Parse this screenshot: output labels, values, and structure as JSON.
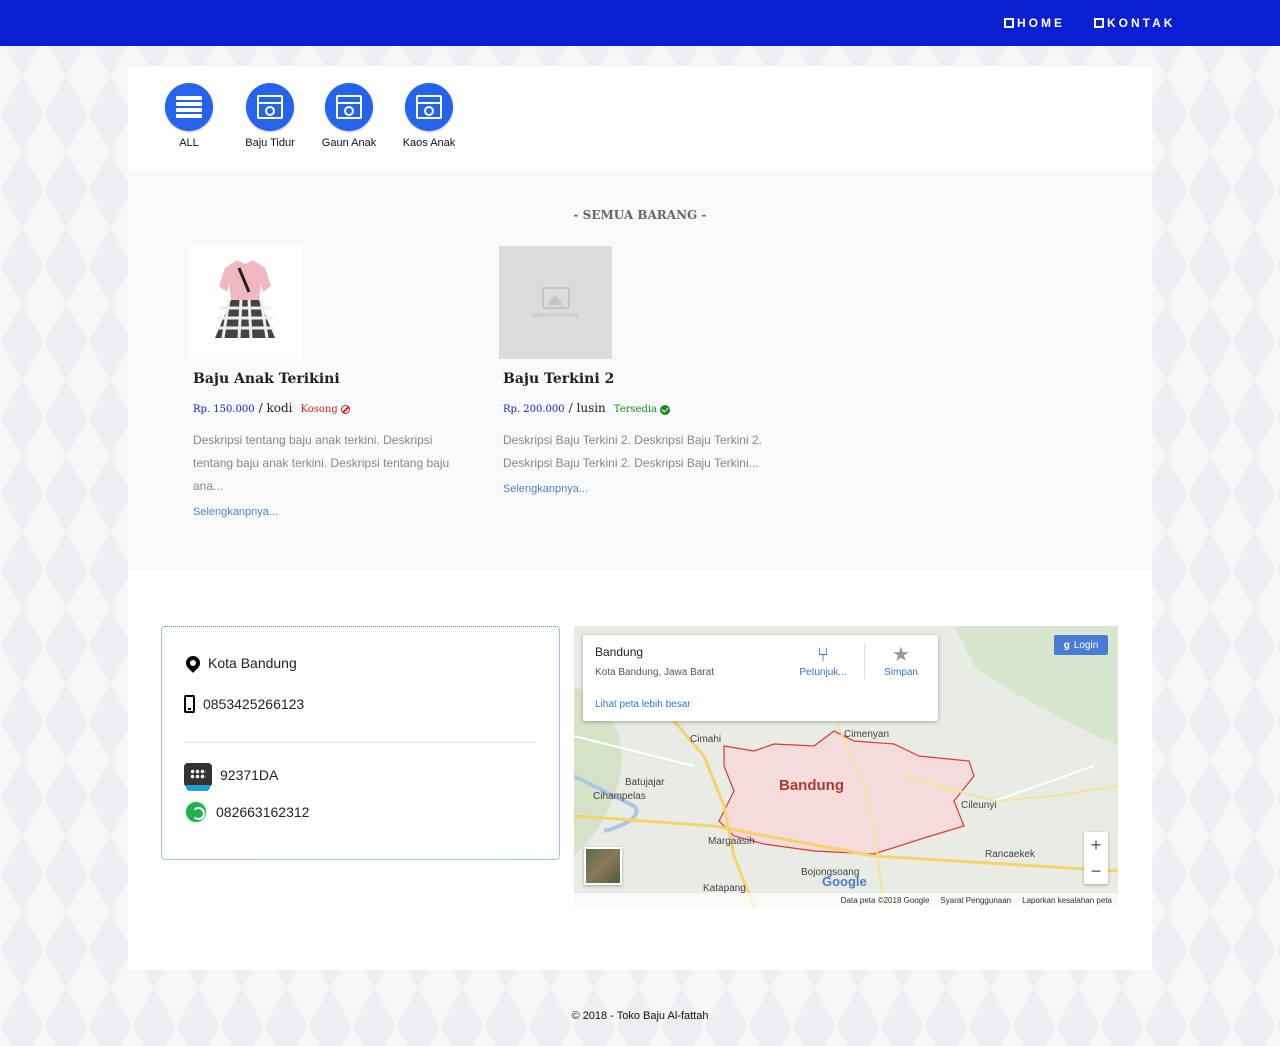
{
  "nav": {
    "home": "HOME",
    "kontak": "KONTAK"
  },
  "categories": [
    {
      "label": "ALL",
      "icon": "list-icon"
    },
    {
      "label": "Baju Tidur",
      "icon": "washer-icon"
    },
    {
      "label": "Gaun Anak",
      "icon": "washer-icon"
    },
    {
      "label": "Kaos Anak",
      "icon": "washer-icon"
    }
  ],
  "section_title": "- SEMUA BARANG -",
  "products": [
    {
      "name": "Baju Anak Terikini",
      "price": "Rp. 150.000",
      "unit": "/ kodi",
      "stock": "Kosong",
      "description": "Deskripsi tentang baju anak terkini. Deskripsi tentang baju anak terkini. Deskripsi tentang baju ana...",
      "more": "Selengkanpnya..."
    },
    {
      "name": "Baju Terkini 2",
      "price": "Rp. 200.000",
      "unit": "/ lusin",
      "stock": "Tersedia",
      "description": "Deskripsi Baju Terkini 2. Deskripsi Baju Terkini 2. Deskripsi Baju Terkini 2. Deskripsi Baju Terkini...",
      "more": "Selengkanpnya...",
      "image_placeholder": "IMAGE NOT FOUND"
    }
  ],
  "contact": {
    "location": "Kota Bandung",
    "phone": "0853425266123",
    "bbm": "92371DA",
    "whatsapp": "082663162312"
  },
  "map": {
    "place": "Bandung",
    "region": "Kota Bandung, Jawa Barat",
    "directions": "Petunjuk...",
    "save": "Simpan",
    "larger_map": "Lihat peta lebih besar",
    "login": "Login",
    "city_label": "Bandung",
    "labels": [
      "Cimahi",
      "Cimenyan",
      "Batujajar",
      "Cihampelas",
      "Cileunyi",
      "Margaasih",
      "Rancaekek",
      "Bojongsoang",
      "Katapang"
    ],
    "google": "Google",
    "footer": [
      "Data peta ©2018 Google",
      "Syarat Penggunaan",
      "Laporkan kesalahan peta"
    ]
  },
  "footer": "© 2018 - Toko Baju Al-fattah",
  "colors": {
    "nav_bg": "#0a1fd1",
    "category_circle": "#2563eb",
    "price": "#1a1ad4",
    "out_of_stock": "#e11d1d",
    "in_stock": "#1d8a1d",
    "link": "#5b7fc7"
  }
}
